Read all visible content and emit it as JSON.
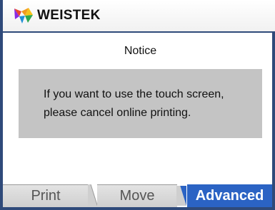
{
  "header": {
    "brand": "WEISTEK",
    "logo_icon": "weistek-logo-icon"
  },
  "notice": {
    "title": "Notice",
    "message_line1": "If you want to use the touch screen,",
    "message_line2": "please cancel online printing."
  },
  "tabs": [
    {
      "label": "Print",
      "active": false
    },
    {
      "label": "Move",
      "active": false
    },
    {
      "label": "Advanced",
      "active": true
    }
  ],
  "colors": {
    "frame": "#2f4a7a",
    "active_tab": "#2b63c4",
    "message_bg": "#c4c4c4"
  }
}
